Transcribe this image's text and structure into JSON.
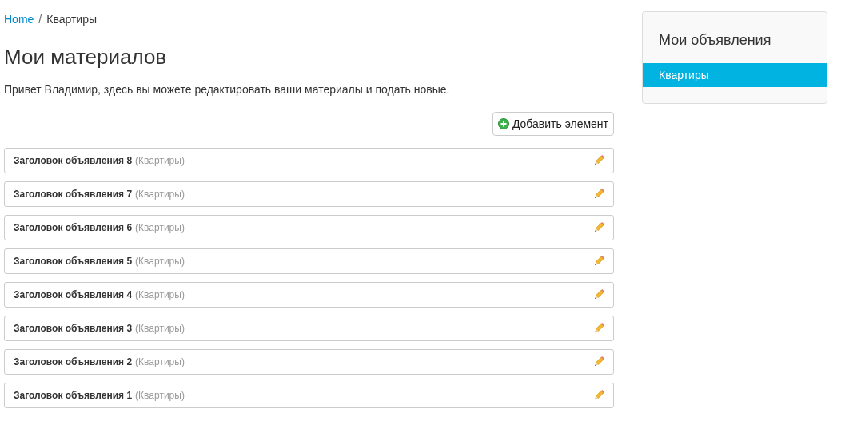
{
  "breadcrumb": [
    {
      "label": "Home",
      "link": true
    },
    {
      "separator": "/",
      "label": "Квартиры",
      "link": false
    }
  ],
  "heading": "Мои материалов",
  "intro": "Привет Владимир, здесь вы можете редактировать ваши материалы и подать новые.",
  "add_button": "Добавить элемент",
  "items": [
    {
      "title": "Заголовок объявления 8",
      "category": "(Квартиры)"
    },
    {
      "title": "Заголовок объявления 7",
      "category": "(Квартиры)"
    },
    {
      "title": "Заголовок объявления 6",
      "category": "(Квартиры)"
    },
    {
      "title": "Заголовок объявления 5",
      "category": "(Квартиры)"
    },
    {
      "title": "Заголовок объявления 4",
      "category": "(Квартиры)"
    },
    {
      "title": "Заголовок объявления 3",
      "category": "(Квартиры)"
    },
    {
      "title": "Заголовок объявления 2",
      "category": "(Квартиры)"
    },
    {
      "title": "Заголовок объявления 1",
      "category": "(Квартиры)"
    }
  ],
  "sidebar": {
    "title": "Мои объявления",
    "items": [
      {
        "label": "Квартиры",
        "selected": true
      }
    ]
  }
}
